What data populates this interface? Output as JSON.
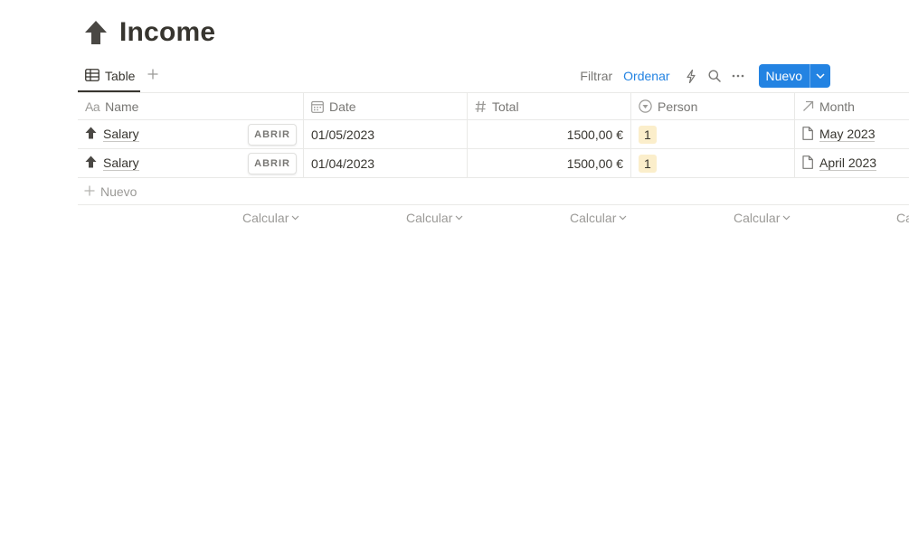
{
  "page": {
    "title": "Income",
    "icon": "up-arrow-icon"
  },
  "toolbar": {
    "view_tab_label": "Table",
    "filter_label": "Filtrar",
    "sort_label": "Ordenar",
    "new_label": "Nuevo",
    "icons": [
      "lightning-icon",
      "search-icon",
      "more-icon",
      "chevron-down-icon"
    ]
  },
  "table": {
    "columns": {
      "name": "Name",
      "date": "Date",
      "total": "Total",
      "person": "Person",
      "month": "Month"
    },
    "name_column_icon_text": "Aa",
    "open_label": "ABRIR",
    "rows": [
      {
        "name": "Salary",
        "date": "01/05/2023",
        "total": "1500,00 €",
        "person": "1",
        "month": "May 2023"
      },
      {
        "name": "Salary",
        "date": "01/04/2023",
        "total": "1500,00 €",
        "person": "1",
        "month": "April 2023"
      }
    ],
    "new_row_label": "Nuevo",
    "calculate_label": "Calcular",
    "calculate_cut_label": "Ca"
  },
  "colors": {
    "accent": "#2383e2",
    "text": "#37352f",
    "muted": "#787774",
    "tag_bg": "#fbeecb"
  }
}
